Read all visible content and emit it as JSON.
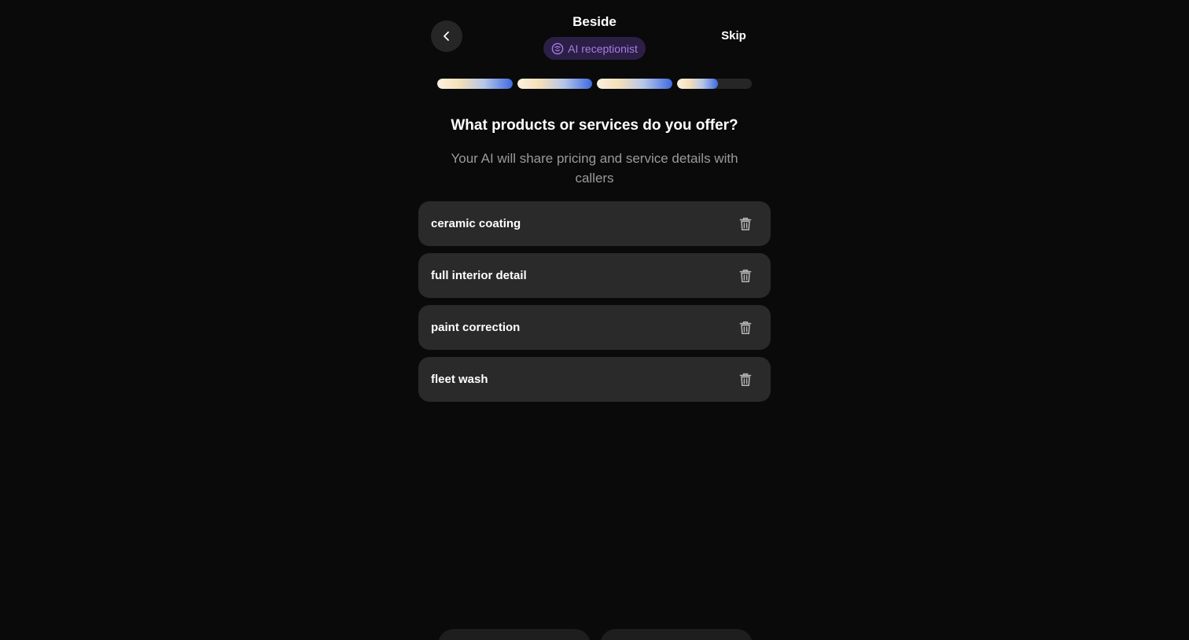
{
  "header": {
    "app_title": "Beside",
    "badge_label": "AI receptionist",
    "skip_label": "Skip",
    "back_icon": "chevron-left-icon",
    "badge_icon": "ai-face-icon"
  },
  "progress": {
    "steps": 4,
    "segments": [
      1,
      1,
      1,
      0.55
    ]
  },
  "main": {
    "question": "What products or services do you offer?",
    "subtitle": "Your AI will share pricing and service details with callers"
  },
  "services": [
    {
      "name": "ceramic coating"
    },
    {
      "name": "full interior detail"
    },
    {
      "name": "paint correction"
    },
    {
      "name": "fleet wash"
    }
  ],
  "colors": {
    "background": "#0a0a0a",
    "card": "#2a2a2a",
    "accent_purple": "#a77ce8",
    "badge_bg": "#2c1f45",
    "progress_start": "#fbf0df",
    "progress_end": "#3e6ae0"
  }
}
